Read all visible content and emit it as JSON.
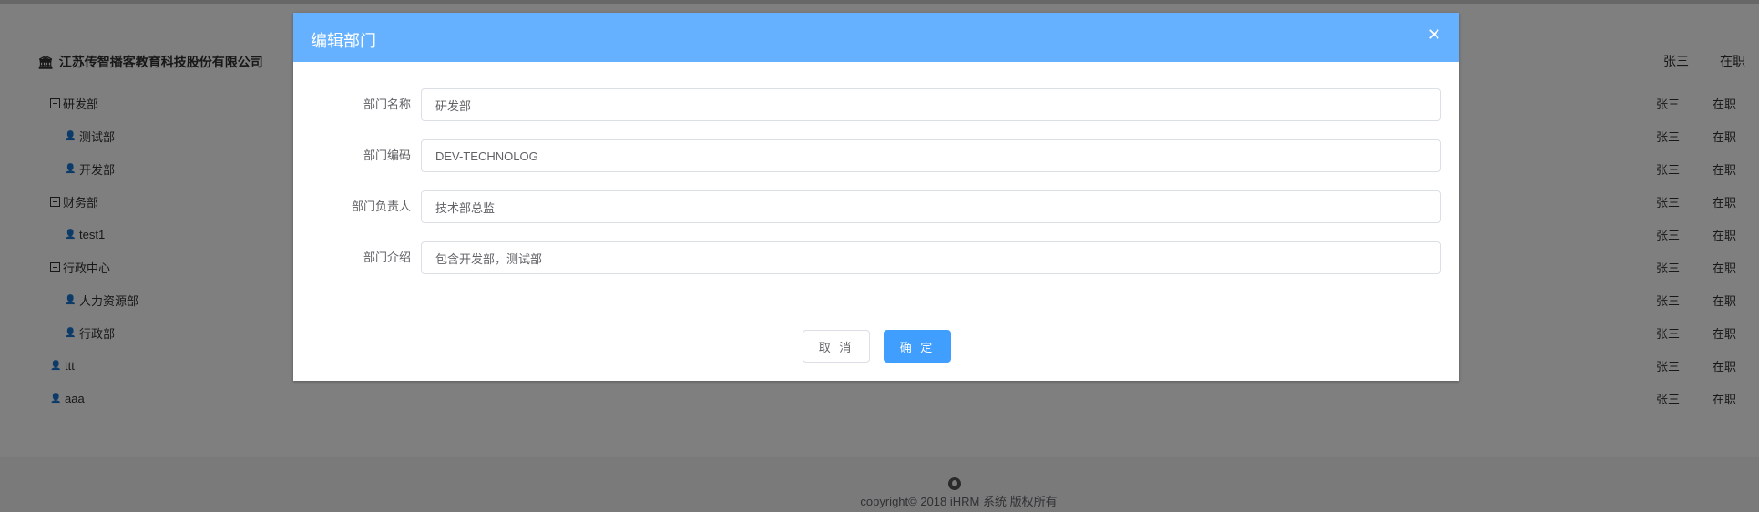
{
  "background": {
    "company": {
      "name": "江苏传智播客教育科技股份有限公司",
      "manager": "张三",
      "status": "在职"
    },
    "tree": [
      {
        "name": "研发部",
        "kind": "group",
        "manager": "张三",
        "status": "在职"
      },
      {
        "name": "测试部",
        "kind": "leaf",
        "manager": "张三",
        "status": "在职"
      },
      {
        "name": "开发部",
        "kind": "leaf",
        "manager": "张三",
        "status": "在职"
      },
      {
        "name": "财务部",
        "kind": "group",
        "manager": "张三",
        "status": "在职"
      },
      {
        "name": "test1",
        "kind": "leaf",
        "manager": "张三",
        "status": "在职"
      },
      {
        "name": "行政中心",
        "kind": "group",
        "manager": "张三",
        "status": "在职"
      },
      {
        "name": "人力资源部",
        "kind": "leaf",
        "manager": "张三",
        "status": "在职"
      },
      {
        "name": "行政部",
        "kind": "leaf",
        "manager": "张三",
        "status": "在职"
      },
      {
        "name": "ttt",
        "kind": "root-leaf",
        "manager": "张三",
        "status": "在职"
      },
      {
        "name": "aaa",
        "kind": "root-leaf",
        "manager": "张三",
        "status": "在职"
      }
    ],
    "footer": {
      "copyright": "copyright© 2018 iHRM 系统 版权所有"
    }
  },
  "dialog": {
    "title": "编辑部门",
    "fields": [
      {
        "label": "部门名称",
        "value": "研发部"
      },
      {
        "label": "部门编码",
        "value": "DEV-TECHNOLOG"
      },
      {
        "label": "部门负责人",
        "value": "技术部总监"
      },
      {
        "label": "部门介绍",
        "value": "包含开发部，测试部"
      }
    ],
    "cancel_label": "取 消",
    "confirm_label": "确 定"
  },
  "colors": {
    "header": "#66b1ff",
    "primary": "#409eff",
    "mask": "rgba(0,0,0,0.5)"
  },
  "icons": {
    "company": "bank-icon",
    "group": "minus-square-icon",
    "leaf": "person-icon",
    "close": "close-icon",
    "footer": "github-icon"
  }
}
